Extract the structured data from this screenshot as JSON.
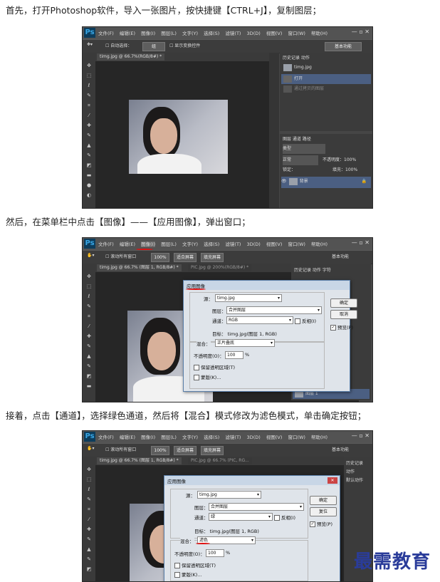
{
  "captions": {
    "step1": "首先，打开Photoshop软件，导入一张图片，按快捷键【CTRL+J】，复制图层；",
    "step2": "然后，在菜单栏中点击【图像】——【应用图像】，弹出窗口；",
    "step3": "接着，点击【通道】，选择绿色通道，然后将【混合】模式修改为滤色模式，单击确定按钮；"
  },
  "ps": {
    "logo": "Ps",
    "menus": [
      "文件(F)",
      "编辑(E)",
      "图像(I)",
      "图层(L)",
      "文字(Y)",
      "选择(S)",
      "滤镜(T)",
      "3D(D)",
      "视图(V)",
      "窗口(W)",
      "帮助(H)"
    ],
    "window_buttons": "— ▫ ✕"
  },
  "shot1": {
    "options": {
      "auto_select": "自动选择：",
      "group": "组",
      "transform": "显示变换控件"
    },
    "basic": "基本功能",
    "doc_tab": "timg.jpg @ 66.7%(RGB/8#) *",
    "history_tabs": "历史记录  动作",
    "history_items": [
      "timg.jpg",
      "打开",
      "通过拷贝的图层"
    ],
    "layers_tabs": "图层  通道  路径",
    "kind": "类型",
    "blend": "正常",
    "opacity": "不透明度：100%",
    "lock": "锁定：",
    "fill": "填充：100%",
    "layer_name": "背景"
  },
  "shot2": {
    "options": {
      "all_windows": "滚动所有窗口",
      "zoom": "100%",
      "fit": "适合屏幕",
      "fill": "填充屏幕"
    },
    "basic": "基本功能",
    "tab1": "timg.jpg @ 66.7% (图层 1, RGB/8#) *",
    "tab2": "PIC.jpg @ 200%(RGB/8#) *",
    "panel_tabs": "历史记录  动作  字符",
    "layer_name": "图层 1",
    "dialog": {
      "title": "应用图像",
      "source_label": "源：",
      "source": "timg.jpg",
      "layer_label": "图层：",
      "layer": "合并图层",
      "channel_label": "通道：",
      "channel": "RGB",
      "invert": "反相(I)",
      "target": "目标：   timg.jpg(图层 1, RGB)",
      "blend_label": "混合：",
      "blend": "正片叠底",
      "opacity_label": "不透明度(O)：",
      "opacity": "100",
      "percent": "%",
      "preserve": "保留透明区域(T)",
      "mask": "蒙版(K)...",
      "ok": "确定",
      "cancel": "取消",
      "preview": "预览(P)"
    }
  },
  "shot3": {
    "options": {
      "all_windows": "滚动所有窗口",
      "zoom": "100%",
      "fit": "适合屏幕",
      "fill": "填充屏幕"
    },
    "basic": "基本功能",
    "tab1": "timg.jpg @ 66.7% (图层 1, RGB/8#) *",
    "tab2": "PIC.jpg @ 66.7% (PIC, RG...",
    "panel_items": [
      "历史记录",
      "动作",
      "默认动作"
    ],
    "dialog": {
      "title": "应用图像",
      "source_label": "源：",
      "source": "timg.jpg",
      "layer_label": "图层：",
      "layer": "合并图层",
      "channel_label": "通道：",
      "channel": "绿",
      "invert": "反相(I)",
      "target": "目标：   timg.jpg(图层 1, RGB)",
      "blend_label": "混合：",
      "blend": "滤色",
      "opacity_label": "不透明度(O)：",
      "opacity": "100",
      "percent": "%",
      "preserve": "保留透明区域(T)",
      "mask": "蒙版(K)...",
      "ok": "确定",
      "reset": "复位",
      "preview": "预览(P)"
    }
  },
  "watermark": "最需教育",
  "colors": {
    "ps_dark": "#464646",
    "layer_select": "#4b5f82",
    "annotation_red": "#e01010",
    "watermark": "#2a3c9a"
  }
}
